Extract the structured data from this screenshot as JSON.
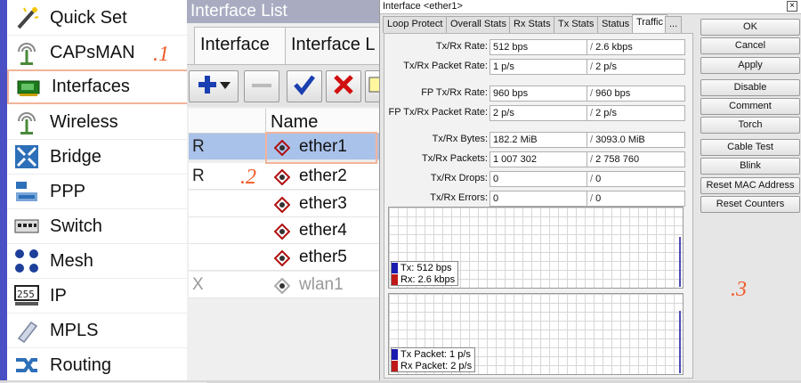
{
  "menu": {
    "items": [
      {
        "label": "Quick Set",
        "icon": "wand-icon"
      },
      {
        "label": "CAPsMAN",
        "icon": "capsman-antenna-icon"
      },
      {
        "label": "Interfaces",
        "icon": "interfaces-card-icon"
      },
      {
        "label": "Wireless",
        "icon": "wireless-antenna-icon"
      },
      {
        "label": "Bridge",
        "icon": "bridge-arrows-icon"
      },
      {
        "label": "PPP",
        "icon": "ppp-icon"
      },
      {
        "label": "Switch",
        "icon": "switch-icon"
      },
      {
        "label": "Mesh",
        "icon": "mesh-icon"
      },
      {
        "label": "IP",
        "icon": "ip-icon"
      },
      {
        "label": "MPLS",
        "icon": "mpls-icon"
      },
      {
        "label": "Routing",
        "icon": "routing-icon"
      }
    ],
    "selected": "Interfaces"
  },
  "steps": {
    "one": ".1",
    "two": ".2",
    "three": ".3"
  },
  "interface_list": {
    "title": "Interface List",
    "tabs": [
      "Interface",
      "Interface L"
    ],
    "column_name": "Name",
    "rows": [
      {
        "flag": "R",
        "name": "ether1"
      },
      {
        "flag": "R",
        "name": "ether2"
      },
      {
        "flag": "",
        "name": "ether3"
      },
      {
        "flag": "",
        "name": "ether4"
      },
      {
        "flag": "",
        "name": "ether5"
      },
      {
        "flag": "X",
        "name": "wlan1"
      }
    ]
  },
  "dialog": {
    "title": "Interface <ether1>",
    "close": "×",
    "tabs": [
      "Loop Protect",
      "Overall Stats",
      "Rx Stats",
      "Tx Stats",
      "Status",
      "Traffic",
      "..."
    ],
    "active_tab": "Traffic",
    "fields": [
      {
        "label": "Tx/Rx Rate:",
        "a": "512 bps",
        "b": "2.6 kbps"
      },
      {
        "label": "Tx/Rx Packet Rate:",
        "a": "1 p/s",
        "b": "2 p/s"
      },
      {
        "label": "FP Tx/Rx Rate:",
        "a": "960 bps",
        "b": "960 bps"
      },
      {
        "label": "FP Tx/Rx Packet Rate:",
        "a": "2 p/s",
        "b": "2 p/s"
      },
      {
        "label": "Tx/Rx Bytes:",
        "a": "182.2 MiB",
        "b": "3093.0 MiB"
      },
      {
        "label": "Tx/Rx Packets:",
        "a": "1 007 302",
        "b": "2 758 760"
      },
      {
        "label": "Tx/Rx Drops:",
        "a": "0",
        "b": "0"
      },
      {
        "label": "Tx/Rx Errors:",
        "a": "0",
        "b": "0"
      }
    ],
    "graph1": {
      "tx": "Tx:  512 bps",
      "rx": "Rx:  2.6 kbps"
    },
    "graph2": {
      "tx": "Tx Packet:  1 p/s",
      "rx": "Rx Packet:  2 p/s"
    },
    "buttons": [
      "OK",
      "Cancel",
      "Apply",
      "Disable",
      "Comment",
      "Torch",
      "Cable Test",
      "Blink",
      "Reset MAC Address",
      "Reset Counters"
    ]
  },
  "colors": {
    "accent_menu": "#4a4fc4",
    "selected_row": "#a9c2ea",
    "step_mark": "#f05a28",
    "tx": "#1b1bb0",
    "rx": "#c01818"
  }
}
